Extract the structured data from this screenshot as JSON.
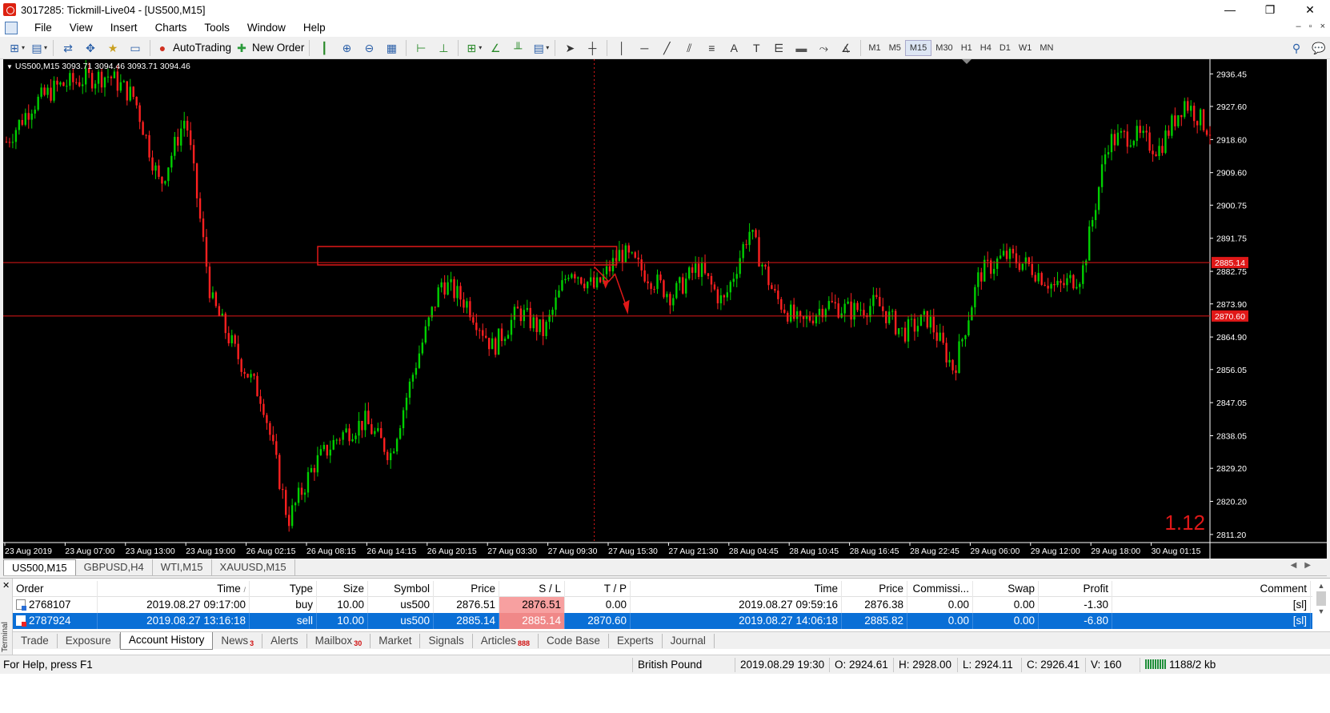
{
  "window": {
    "title": "3017285: Tickmill-Live04 - [US500,M15]",
    "controls": [
      "—",
      "❐",
      "✕"
    ]
  },
  "menu": {
    "items": [
      "File",
      "View",
      "Insert",
      "Charts",
      "Tools",
      "Window",
      "Help"
    ],
    "mdi_controls": [
      "–",
      "▫",
      "×"
    ]
  },
  "toolbar": {
    "autotrading_label": "AutoTrading",
    "new_order_label": "New Order",
    "timeframes": [
      "M1",
      "M5",
      "M15",
      "M30",
      "H1",
      "H4",
      "D1",
      "W1",
      "MN"
    ],
    "active_timeframe": "M15"
  },
  "chart": {
    "info": "US500,M15  3093.71 3094.46 3093.71 3094.46",
    "corner_value": "1.12",
    "colors": {
      "background": "#000000",
      "bull": "#00d000",
      "bear": "#ff2020",
      "line": "#e01818"
    }
  },
  "chart_data": {
    "type": "candlestick",
    "symbol": "US500",
    "timeframe": "M15",
    "y_ticks": [
      "2936.45",
      "2927.60",
      "2918.60",
      "2909.60",
      "2900.75",
      "2891.75",
      "2882.75",
      "2873.90",
      "2864.90",
      "2856.05",
      "2847.05",
      "2838.05",
      "2829.20",
      "2820.20",
      "2811.20"
    ],
    "ylim": [
      2809,
      2940
    ],
    "x_ticks": [
      "23 Aug 2019",
      "23 Aug 07:00",
      "23 Aug 13:00",
      "23 Aug 19:00",
      "26 Aug 02:15",
      "26 Aug 08:15",
      "26 Aug 14:15",
      "26 Aug 20:15",
      "27 Aug 03:30",
      "27 Aug 09:30",
      "27 Aug 15:30",
      "27 Aug 21:30",
      "28 Aug 04:45",
      "28 Aug 10:45",
      "28 Aug 16:45",
      "28 Aug 22:45",
      "29 Aug 06:00",
      "29 Aug 12:00",
      "29 Aug 18:00",
      "30 Aug 01:15"
    ],
    "horizontal_lines": [
      {
        "label": "2885.14",
        "value": 2885.14,
        "color": "#e01818"
      },
      {
        "label": "2870.60",
        "value": 2870.6,
        "color": "#e01818"
      }
    ],
    "vertical_line_at": "27 Aug 09:30",
    "approx_close_path": [
      2918,
      2928,
      2933,
      2935,
      2936,
      2930,
      2906,
      2925,
      2875,
      2860,
      2848,
      2815,
      2830,
      2838,
      2842,
      2833,
      2858,
      2880,
      2874,
      2862,
      2872,
      2866,
      2884,
      2878,
      2888,
      2882,
      2876,
      2884,
      2874,
      2894,
      2876,
      2868,
      2874,
      2872,
      2874,
      2866,
      2870,
      2856,
      2882,
      2887,
      2884,
      2878,
      2882,
      2918,
      2920,
      2916,
      2929,
      2921
    ]
  },
  "chart_tabs": [
    "US500,M15",
    "GBPUSD,H4",
    "WTI,M15",
    "XAUUSD,M15"
  ],
  "terminal": {
    "side_label": "Terminal",
    "columns": [
      "Order",
      "Time",
      "Type",
      "Size",
      "Symbol",
      "Price",
      "S / L",
      "T / P",
      "Time",
      "Price",
      "Commissi...",
      "Swap",
      "Profit",
      "Comment"
    ],
    "rows": [
      [
        "2768107",
        "2019.08.27 09:17:00",
        "buy",
        "10.00",
        "us500",
        "2876.51",
        "2876.51",
        "0.00",
        "2019.08.27 09:59:16",
        "2876.38",
        "0.00",
        "0.00",
        "-1.30",
        "[sl]"
      ],
      [
        "2787924",
        "2019.08.27 13:16:18",
        "sell",
        "10.00",
        "us500",
        "2885.14",
        "2885.14",
        "2870.60",
        "2019.08.27 14:06:18",
        "2885.82",
        "0.00",
        "0.00",
        "-6.80",
        "[sl]"
      ]
    ],
    "tabs": [
      {
        "label": "Trade",
        "badge": ""
      },
      {
        "label": "Exposure",
        "badge": ""
      },
      {
        "label": "Account History",
        "badge": ""
      },
      {
        "label": "News",
        "badge": "3"
      },
      {
        "label": "Alerts",
        "badge": ""
      },
      {
        "label": "Mailbox",
        "badge": "30"
      },
      {
        "label": "Market",
        "badge": ""
      },
      {
        "label": "Signals",
        "badge": ""
      },
      {
        "label": "Articles",
        "badge": "888"
      },
      {
        "label": "Code Base",
        "badge": ""
      },
      {
        "label": "Experts",
        "badge": ""
      },
      {
        "label": "Journal",
        "badge": ""
      }
    ],
    "active_tab": "Account History"
  },
  "status": {
    "help": "For Help, press F1",
    "profile": "British Pound",
    "datetime": "2019.08.29 19:30",
    "open": "O: 2924.61",
    "high": "H: 2928.00",
    "low": "L: 2924.11",
    "close": "C: 2926.41",
    "volume": "V: 160",
    "traffic": "1188/2 kb"
  }
}
